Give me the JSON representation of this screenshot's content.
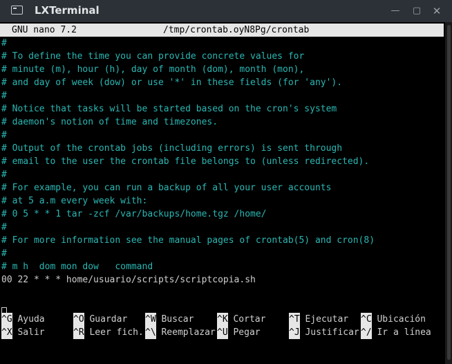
{
  "window": {
    "title": "LXTerminal",
    "icon": "terminal-icon",
    "controls": {
      "minimize": "—",
      "maximize": "▢",
      "close": "✕"
    }
  },
  "nano": {
    "version": "GNU nano 7.2",
    "filename": "/tmp/crontab.oyN8Pg/crontab"
  },
  "content_lines": [
    {
      "text": "#",
      "kind": "comment"
    },
    {
      "text": "# To define the time you can provide concrete values for",
      "kind": "comment"
    },
    {
      "text": "# minute (m), hour (h), day of month (dom), month (mon),",
      "kind": "comment"
    },
    {
      "text": "# and day of week (dow) or use '*' in these fields (for 'any').",
      "kind": "comment"
    },
    {
      "text": "#",
      "kind": "comment"
    },
    {
      "text": "# Notice that tasks will be started based on the cron's system",
      "kind": "comment"
    },
    {
      "text": "# daemon's notion of time and timezones.",
      "kind": "comment"
    },
    {
      "text": "#",
      "kind": "comment"
    },
    {
      "text": "# Output of the crontab jobs (including errors) is sent through",
      "kind": "comment"
    },
    {
      "text": "# email to the user the crontab file belongs to (unless redirected).",
      "kind": "comment"
    },
    {
      "text": "#",
      "kind": "comment"
    },
    {
      "text": "# For example, you can run a backup of all your user accounts",
      "kind": "comment"
    },
    {
      "text": "# at 5 a.m every week with:",
      "kind": "comment"
    },
    {
      "text": "# 0 5 * * 1 tar -zcf /var/backups/home.tgz /home/",
      "kind": "comment"
    },
    {
      "text": "#",
      "kind": "comment"
    },
    {
      "text": "# For more information see the manual pages of crontab(5) and cron(8)",
      "kind": "comment"
    },
    {
      "text": "#",
      "kind": "comment"
    },
    {
      "text": "# m h  dom mon dow   command",
      "kind": "comment"
    },
    {
      "text": "00 22 * * * home/usuario/scripts/scriptcopia.sh",
      "kind": "plain"
    }
  ],
  "shortcuts": [
    {
      "key": "^G",
      "label": "Ayuda"
    },
    {
      "key": "^O",
      "label": "Guardar"
    },
    {
      "key": "^W",
      "label": "Buscar"
    },
    {
      "key": "^K",
      "label": "Cortar"
    },
    {
      "key": "^T",
      "label": "Ejecutar"
    },
    {
      "key": "^C",
      "label": "Ubicación"
    },
    {
      "key": "^X",
      "label": "Salir"
    },
    {
      "key": "^R",
      "label": "Leer fich."
    },
    {
      "key": "^\\",
      "label": "Reemplazar"
    },
    {
      "key": "^U",
      "label": "Pegar"
    },
    {
      "key": "^J",
      "label": "Justificar"
    },
    {
      "key": "^/",
      "label": "Ir a línea"
    }
  ],
  "colors": {
    "comment": "#2ab7b3",
    "titlebar": "#2b3136",
    "header_bg": "#e6e6e6"
  }
}
